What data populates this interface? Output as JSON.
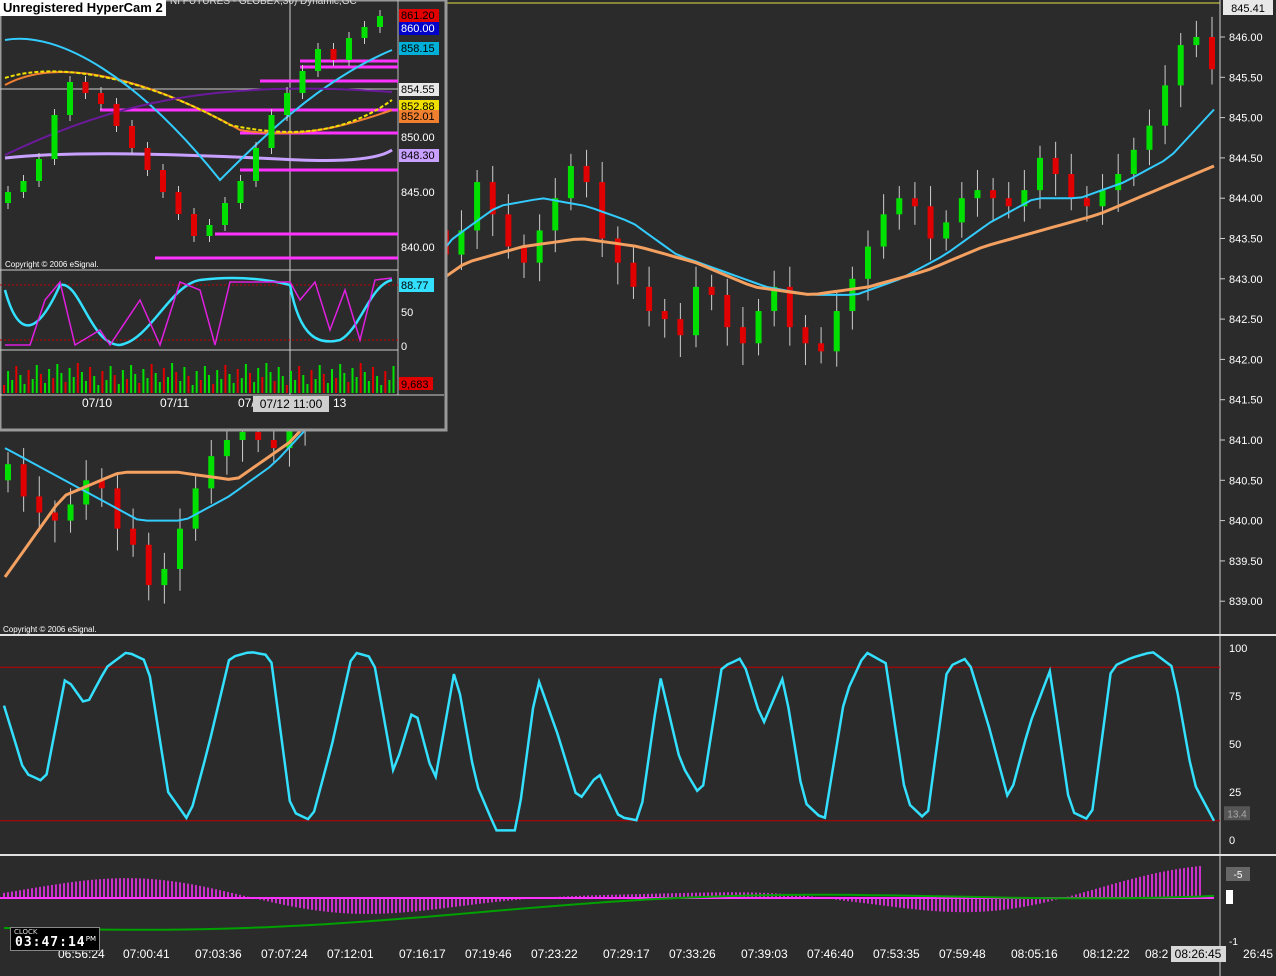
{
  "window": {
    "watermark": "Unregistered HyperCam 2",
    "inset_title_fragment": "NI FUTURES - GLOBEX,30) Dynamic,GC"
  },
  "clock": {
    "label": "CLOCK",
    "time": "03:47:14",
    "ampm": "PM"
  },
  "copyright": "Copyright © 2006 eSignal.",
  "current_price_tag": "845.41",
  "crosshair_date_tag": "07/12 11:00",
  "last_time_tag": "08:26:45",
  "time_axis": [
    "06:56:24",
    "07:00:41",
    "07:03:36",
    "07:07:24",
    "07:12:01",
    "07:16:17",
    "07:19:46",
    "07:23:22",
    "07:29:17",
    "07:33:26",
    "07:39:03",
    "07:46:40",
    "07:53:35",
    "07:59:48",
    "08:05:16",
    "08:12:22",
    "08:2",
    "26:45"
  ],
  "stoch_axis": [
    "100",
    "75",
    "50",
    "25",
    "0"
  ],
  "stoch_tag": "13.4",
  "macd_axis_top": "-5",
  "macd_axis_bottom": "-1",
  "inset": {
    "price_tags": [
      {
        "text": "861.20",
        "bg": "#e00000",
        "fg": "#000000"
      },
      {
        "text": "860.00",
        "bg": "#0000c8",
        "fg": "#ffffff"
      },
      {
        "text": "858.15",
        "bg": "#00b0d8",
        "fg": "#000000"
      },
      {
        "text": "854.55",
        "bg": "#e8e8e8",
        "fg": "#000000"
      },
      {
        "text": "852.88",
        "bg": "#f0e000",
        "fg": "#000000"
      },
      {
        "text": "852.01",
        "bg": "#f08030",
        "fg": "#000000"
      },
      {
        "text": "848.30",
        "bg": "#c8a0ff",
        "fg": "#000000"
      }
    ],
    "price_axis": [
      "850.00",
      "845.00",
      "840.00"
    ],
    "stoch_tag": "88.77",
    "stoch_axis": [
      "50",
      "0"
    ],
    "volume_tag": "9,683",
    "date_axis": [
      "07/10",
      "07/11",
      "07/",
      "13"
    ]
  },
  "colors": {
    "background": "#2b2b2b",
    "bull": "#00e000",
    "bear": "#e00000",
    "ema_fast": "#33ccff",
    "ema_slow": "#f4a060",
    "stoch": "#33e0ff",
    "stoch_level": "#c00000",
    "histogram": "#ff33ff",
    "signal": "#00a000"
  },
  "chart_data": {
    "type": "candlestick",
    "instrument_fragment": "NI FUTURES - GLOBEX,30",
    "x_labels": [
      "06:56:24",
      "07:00:41",
      "07:03:36",
      "07:07:24",
      "07:12:01",
      "07:16:17",
      "07:19:46",
      "07:23:22",
      "07:29:17",
      "07:33:26",
      "07:39:03",
      "07:46:40",
      "07:53:35",
      "07:59:48",
      "08:05:16",
      "08:12:22",
      "08:26:45"
    ],
    "y_ticks": [
      846.0,
      845.5,
      845.0,
      844.5,
      844.0,
      843.5,
      843.0,
      842.5,
      842.0,
      841.5,
      841.0,
      840.5,
      840.0,
      839.5,
      839.0
    ],
    "ylim": [
      838.7,
      846.4
    ],
    "last_price": 845.41,
    "series_close": [
      840.7,
      840.3,
      840.1,
      840.0,
      840.2,
      840.5,
      840.4,
      839.9,
      839.7,
      839.2,
      839.4,
      839.9,
      840.4,
      840.8,
      841.0,
      841.1,
      841.0,
      840.9,
      841.2,
      841.6,
      842.2,
      843.0,
      844.0,
      844.4,
      844.2,
      843.8,
      843.9,
      843.6,
      843.3,
      843.6,
      844.2,
      843.8,
      843.4,
      843.2,
      843.6,
      844.0,
      844.4,
      844.2,
      843.5,
      843.2,
      842.9,
      842.6,
      842.5,
      842.3,
      842.9,
      842.8,
      842.4,
      842.2,
      842.6,
      842.9,
      842.4,
      842.2,
      842.1,
      842.6,
      843.0,
      843.4,
      843.8,
      844.0,
      843.9,
      843.5,
      843.7,
      844.0,
      844.1,
      844.0,
      843.9,
      844.1,
      844.5,
      844.3,
      844.0,
      843.9,
      844.1,
      844.3,
      844.6,
      844.9,
      845.4,
      845.9,
      846.0,
      845.6
    ],
    "ema_fast_close": [
      840.9,
      840.6,
      840.3,
      840.0,
      840.0,
      840.3,
      840.7,
      841.3,
      842.0,
      842.8,
      843.5,
      843.9,
      844.0,
      843.9,
      843.7,
      843.3,
      843.1,
      842.9,
      842.8,
      842.8,
      843.0,
      843.3,
      843.7,
      844.0,
      844.0,
      844.2,
      844.5,
      845.1
    ],
    "ema_slow_close": [
      839.3,
      840.3,
      840.6,
      840.6,
      840.5,
      841.0,
      841.9,
      842.7,
      843.2,
      843.4,
      843.5,
      843.4,
      843.2,
      842.9,
      842.8,
      842.9,
      843.1,
      843.4,
      843.6,
      843.8,
      844.1,
      844.4
    ],
    "stochastic": [
      70,
      35,
      30,
      85,
      70,
      90,
      98,
      93,
      25,
      10,
      50,
      95,
      98,
      96,
      15,
      10,
      50,
      98,
      95,
      35,
      70,
      30,
      90,
      30,
      5,
      5,
      85,
      55,
      20,
      35,
      12,
      10,
      85,
      40,
      22,
      90,
      95,
      60,
      85,
      20,
      10,
      75,
      98,
      92,
      20,
      10,
      90,
      95,
      60,
      20,
      60,
      88,
      15,
      10,
      90,
      95,
      98,
      90,
      30,
      10
    ],
    "stochastic_levels": [
      90,
      10
    ],
    "macd_histogram_trend": "negative-to-positive",
    "macd_signal_trend": "rising"
  }
}
